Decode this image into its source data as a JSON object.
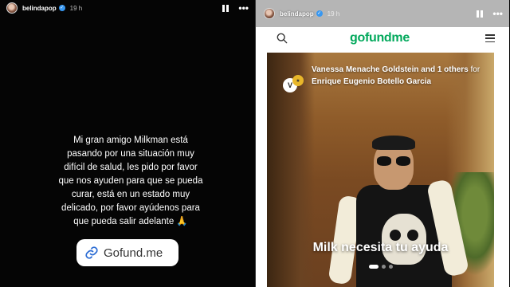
{
  "stories": {
    "left": {
      "username": "belindapop",
      "time": "19 h",
      "message": "Mi gran amigo Milkman está pasando por una situación muy difícil de salud, les pido por favor que nos ayuden para que se pueda curar, está en un estado muy delicado, por favor ayúdenos para que pueda salir adelante 🙏",
      "link_sticker": "Gofund.me"
    },
    "right": {
      "username": "belindapop",
      "time": "19 h",
      "gofundme": {
        "logo": "gofundme",
        "organizer": "Vanessa Menache Goldstein and 1 others",
        "for_word": "for",
        "beneficiary": "Enrique Eugenio Botello Garcia",
        "avatar_initial": "V",
        "caption": "Milk necesita tu ayuda"
      }
    }
  },
  "colors": {
    "gofundme_green": "#02a95c",
    "verified_blue": "#3897f0"
  },
  "icons": [
    "avatar",
    "verified-icon",
    "pause-icon",
    "more-icon",
    "link-icon",
    "search-icon",
    "menu-icon"
  ]
}
